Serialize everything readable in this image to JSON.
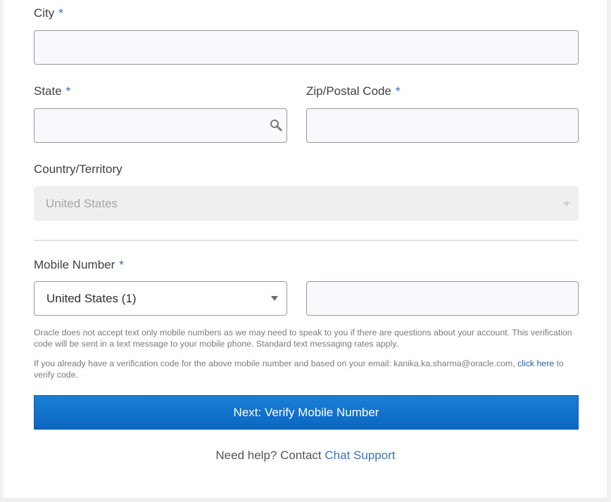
{
  "form": {
    "city": {
      "label": "City",
      "required_mark": "*",
      "value": ""
    },
    "state": {
      "label": "State",
      "required_mark": "*",
      "value": "",
      "icon": "search-icon"
    },
    "zip": {
      "label": "Zip/Postal Code",
      "required_mark": "*",
      "value": ""
    },
    "country": {
      "label": "Country/Territory",
      "value": "United States"
    },
    "mobile": {
      "label": "Mobile Number",
      "required_mark": "*",
      "country_code": "United States (1)",
      "number": ""
    }
  },
  "notes": {
    "text_only": "Oracle does not accept text only mobile numbers as we may need to speak to you if there are questions about your account. This verification code will be sent in a text message to your mobile phone. Standard text messaging rates apply.",
    "verify_prefix": "If you already have a verification code for the above mobile number and based on your email: kanika.ka.sharma@oracle.com,",
    "verify_link": "click here",
    "verify_suffix": "to verify code."
  },
  "actions": {
    "next_label": "Next: Verify Mobile Number"
  },
  "help": {
    "prefix": "Need help? Contact",
    "link": "Chat Support"
  },
  "colors": {
    "accent": "#0b67c2",
    "required": "#1f6cc4",
    "link": "#1f5fa8"
  }
}
